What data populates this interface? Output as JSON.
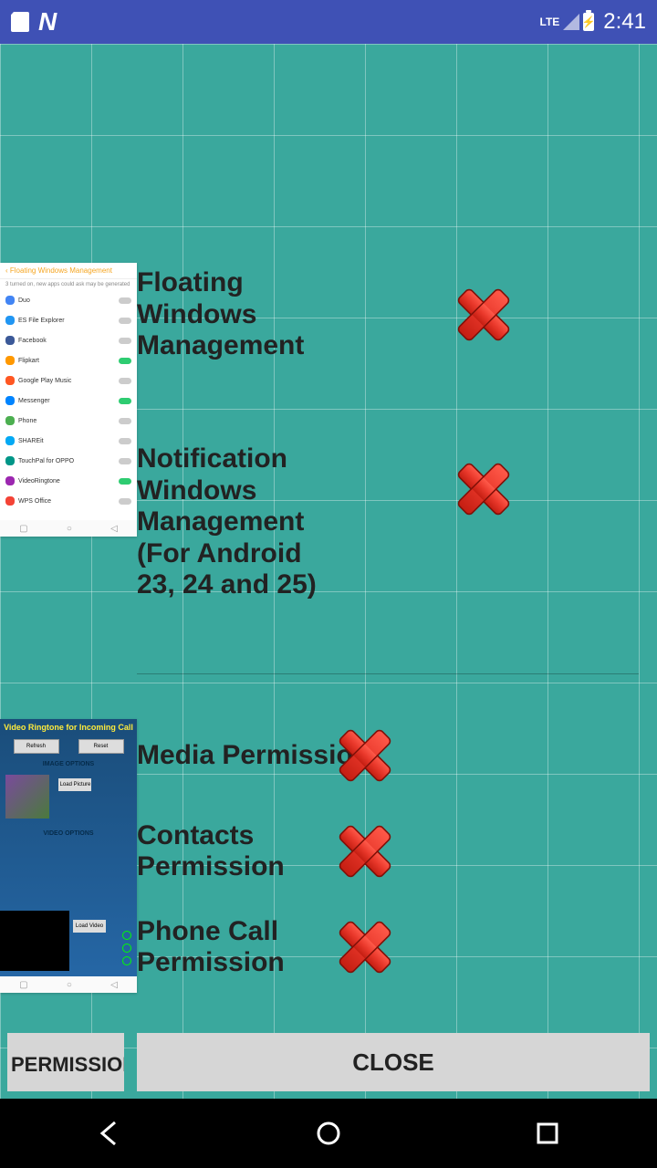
{
  "statusbar": {
    "lte": "LTE",
    "time": "2:41"
  },
  "permissions": {
    "floating": "Floating Windows Management",
    "notification": "Notification Windows Management (For Android 23, 24 and 25)",
    "media": "Media Permission",
    "contacts": "Contacts Permission",
    "phone": "Phone Call Permission"
  },
  "thumb1": {
    "header": "‹  Floating Windows Management",
    "sub": "3 turned on, new apps could ask may be generated",
    "rows": [
      {
        "label": "Duo",
        "on": false,
        "color": "#4285f4"
      },
      {
        "label": "ES File Explorer",
        "on": false,
        "color": "#2196f3"
      },
      {
        "label": "Facebook",
        "on": false,
        "color": "#3b5998"
      },
      {
        "label": "Flipkart",
        "on": true,
        "color": "#ff9800"
      },
      {
        "label": "Google Play Music",
        "on": false,
        "color": "#ff5722"
      },
      {
        "label": "Messenger",
        "on": true,
        "color": "#0084ff"
      },
      {
        "label": "Phone",
        "on": false,
        "color": "#4caf50"
      },
      {
        "label": "SHAREit",
        "on": false,
        "color": "#03a9f4"
      },
      {
        "label": "TouchPal for OPPO",
        "on": false,
        "color": "#009688"
      },
      {
        "label": "VideoRingtone",
        "on": true,
        "color": "#9c27b0"
      },
      {
        "label": "WPS Office",
        "on": false,
        "color": "#f44336"
      }
    ]
  },
  "thumb2": {
    "title": "Video Ringtone for Incoming Call",
    "btn1": "Refresh",
    "btn2": "Reset",
    "label1": "IMAGE OPTIONS",
    "loadpic": "Load Picture",
    "label2": "VIDEO OPTIONS",
    "loadvid": "Load Video"
  },
  "buttons": {
    "permissions": "PERMISSIONS..",
    "close": "CLOSE"
  }
}
